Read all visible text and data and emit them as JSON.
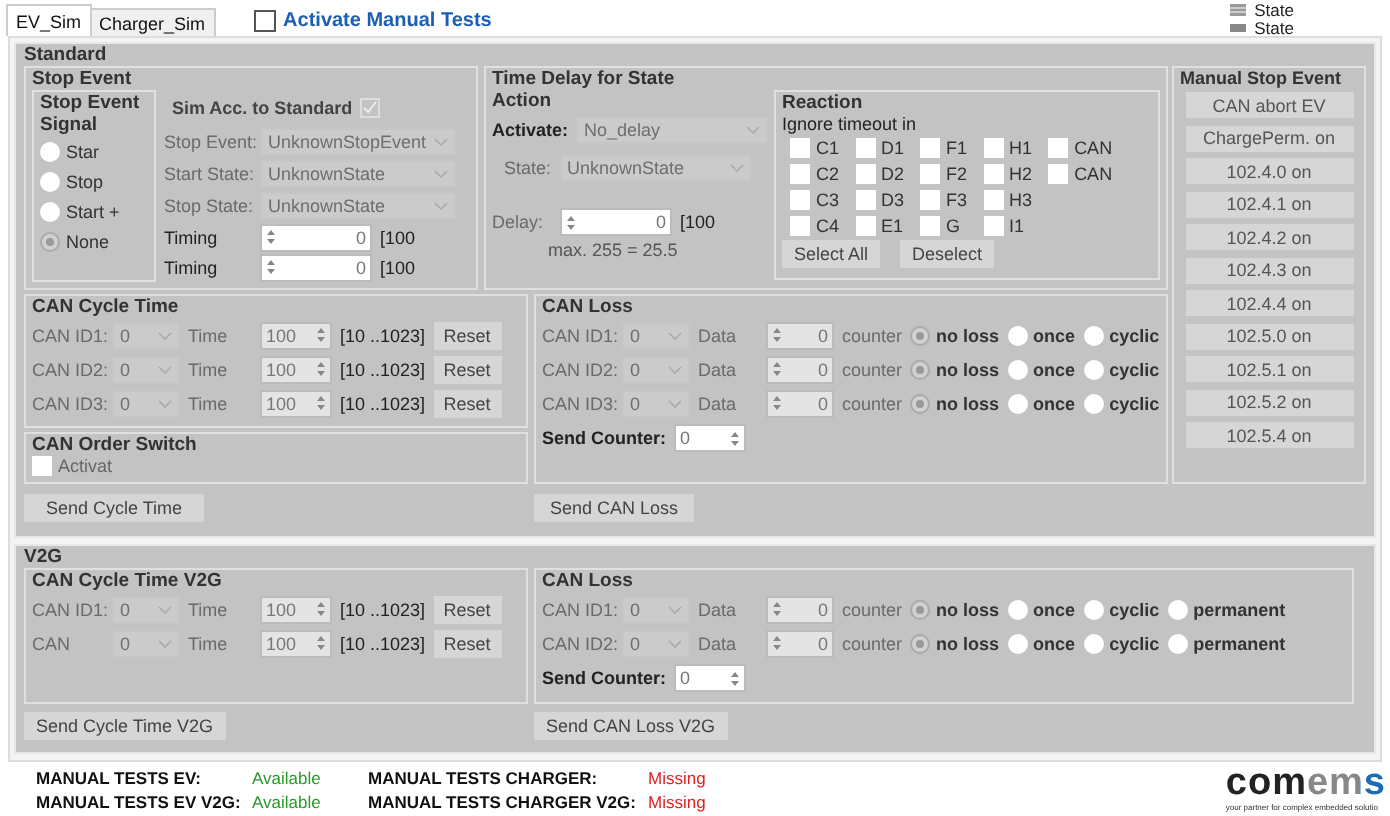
{
  "tabs": [
    {
      "label": "EV_Sim",
      "selected": true
    },
    {
      "label": "Charger_Sim",
      "selected": false
    }
  ],
  "activate_manual_tests": {
    "label": "Activate Manual Tests",
    "checked": false
  },
  "legend": [
    {
      "kind": "hatched",
      "label": "State"
    },
    {
      "kind": "solid",
      "label": "State"
    }
  ],
  "standard": {
    "title": "Standard",
    "stop_event": {
      "title": "Stop Event",
      "signal": {
        "title": "Stop Event Signal",
        "options": [
          {
            "label": "Star",
            "selected": false
          },
          {
            "label": "Stop",
            "selected": false
          },
          {
            "label": "Start +",
            "selected": false
          },
          {
            "label": "None",
            "selected": true
          }
        ]
      },
      "sim": {
        "title": "Sim Acc. to Standard",
        "checked": true,
        "selects": [
          {
            "label": "Stop Event:",
            "value": "UnknownStopEvent"
          },
          {
            "label": "Start State:",
            "value": "UnknownState"
          },
          {
            "label": "Stop State:",
            "value": "UnknownState"
          }
        ],
        "timings": [
          {
            "label": "Timing",
            "value": "0",
            "range": "[100"
          },
          {
            "label": "Timing",
            "value": "0",
            "range": "[100"
          }
        ]
      }
    },
    "time_delay": {
      "title": "Time Delay for State",
      "action": {
        "title": "Action",
        "activate": {
          "label": "Activate:",
          "value": "No_delay"
        },
        "state": {
          "label": "State:",
          "value": "UnknownState"
        },
        "delay": {
          "label": "Delay:",
          "value": "0",
          "range": "[100",
          "note": "max. 255 = 25.5"
        }
      },
      "reaction": {
        "title": "Reaction",
        "subtitle": "Ignore timeout in",
        "rows": [
          [
            {
              "label": "C1",
              "checked": false
            },
            {
              "label": "D1",
              "checked": false
            },
            {
              "label": "F1",
              "checked": false
            },
            {
              "label": "H1",
              "checked": false
            },
            {
              "label": "CAN",
              "checked": false
            }
          ],
          [
            {
              "label": "C2",
              "checked": false
            },
            {
              "label": "D2",
              "checked": false
            },
            {
              "label": "F2",
              "checked": false
            },
            {
              "label": "H2",
              "checked": false
            },
            {
              "label": "CAN",
              "checked": false
            }
          ],
          [
            {
              "label": "C3",
              "checked": false
            },
            {
              "label": "D3",
              "checked": false
            },
            {
              "label": "F3",
              "checked": false
            },
            {
              "label": "H3",
              "checked": false
            }
          ],
          [
            {
              "label": "C4",
              "checked": false
            },
            {
              "label": "E1",
              "checked": false
            },
            {
              "label": "G",
              "checked": false
            },
            {
              "label": "I1",
              "checked": false
            }
          ]
        ],
        "buttons": [
          "Select All",
          "Deselect"
        ]
      }
    },
    "manual_stop_event": {
      "title": "Manual Stop Event",
      "buttons": [
        "CAN abort EV",
        "ChargePerm. on",
        "102.4.0 on",
        "102.4.1 on",
        "102.4.2 on",
        "102.4.3 on",
        "102.4.4 on",
        "102.5.0 on",
        "102.5.1 on",
        "102.5.2 on",
        "102.5.4 on"
      ]
    },
    "can_cycle_time": {
      "title": "CAN Cycle Time",
      "rows": [
        {
          "label": "CAN ID1:",
          "id": "0",
          "time_label": "Time",
          "value": "100",
          "range": "[10 ..1023]",
          "button": "Reset"
        },
        {
          "label": "CAN ID2:",
          "id": "0",
          "time_label": "Time",
          "value": "100",
          "range": "[10 ..1023]",
          "button": "Reset"
        },
        {
          "label": "CAN ID3:",
          "id": "0",
          "time_label": "Time",
          "value": "100",
          "range": "[10 ..1023]",
          "button": "Reset"
        }
      ]
    },
    "can_order_switch": {
      "title": "CAN Order Switch",
      "checkbox": {
        "label": "Activat",
        "checked": false
      }
    },
    "send_cycle_button": "Send Cycle Time",
    "can_loss": {
      "title": "CAN Loss",
      "rows": [
        {
          "label": "CAN ID1:",
          "id": "0",
          "data_label": "Data",
          "value": "0",
          "counter_label": "counter",
          "options": [
            {
              "label": "no loss",
              "selected": true
            },
            {
              "label": "once",
              "selected": false
            },
            {
              "label": "cyclic",
              "selected": false
            }
          ]
        },
        {
          "label": "CAN ID2:",
          "id": "0",
          "data_label": "Data",
          "value": "0",
          "counter_label": "counter",
          "options": [
            {
              "label": "no loss",
              "selected": true
            },
            {
              "label": "once",
              "selected": false
            },
            {
              "label": "cyclic",
              "selected": false
            }
          ]
        },
        {
          "label": "CAN ID3:",
          "id": "0",
          "data_label": "Data",
          "value": "0",
          "counter_label": "counter",
          "options": [
            {
              "label": "no loss",
              "selected": true
            },
            {
              "label": "once",
              "selected": false
            },
            {
              "label": "cyclic",
              "selected": false
            }
          ]
        }
      ],
      "send_counter": {
        "label": "Send Counter:",
        "value": "0"
      }
    },
    "send_loss_button": "Send CAN Loss"
  },
  "v2g": {
    "title": "V2G",
    "can_cycle_time": {
      "title": "CAN Cycle Time V2G",
      "rows": [
        {
          "label": "CAN ID1:",
          "id": "0",
          "time_label": "Time",
          "value": "100",
          "range": "[10 ..1023]",
          "button": "Reset"
        },
        {
          "label": "CAN",
          "id": "0",
          "time_label": "Time",
          "value": "100",
          "range": "[10 ..1023]",
          "button": "Reset"
        }
      ]
    },
    "send_cycle_button": "Send Cycle Time V2G",
    "can_loss": {
      "title": "CAN Loss",
      "rows": [
        {
          "label": "CAN ID1:",
          "id": "0",
          "data_label": "Data",
          "value": "0",
          "counter_label": "counter",
          "options": [
            {
              "label": "no loss",
              "selected": true
            },
            {
              "label": "once",
              "selected": false
            },
            {
              "label": "cyclic",
              "selected": false
            },
            {
              "label": "permanent",
              "selected": false
            }
          ]
        },
        {
          "label": "CAN ID2:",
          "id": "0",
          "data_label": "Data",
          "value": "0",
          "counter_label": "counter",
          "options": [
            {
              "label": "no loss",
              "selected": true
            },
            {
              "label": "once",
              "selected": false
            },
            {
              "label": "cyclic",
              "selected": false
            },
            {
              "label": "permanent",
              "selected": false
            }
          ]
        }
      ],
      "send_counter": {
        "label": "Send Counter:",
        "value": "0"
      }
    },
    "send_loss_button": "Send CAN Loss V2G"
  },
  "status": [
    {
      "label": "MANUAL TESTS EV:",
      "value": "Available",
      "available": true
    },
    {
      "label": "MANUAL TESTS CHARGER:",
      "value": "Missing",
      "available": false
    },
    {
      "label": "MANUAL TESTS EV V2G:",
      "value": "Available",
      "available": true
    },
    {
      "label": "MANUAL TESTS CHARGER V2G:",
      "value": "Missing",
      "available": false
    }
  ],
  "logo": {
    "name": "comems",
    "tagline": "your partner for complex embedded solutio"
  }
}
